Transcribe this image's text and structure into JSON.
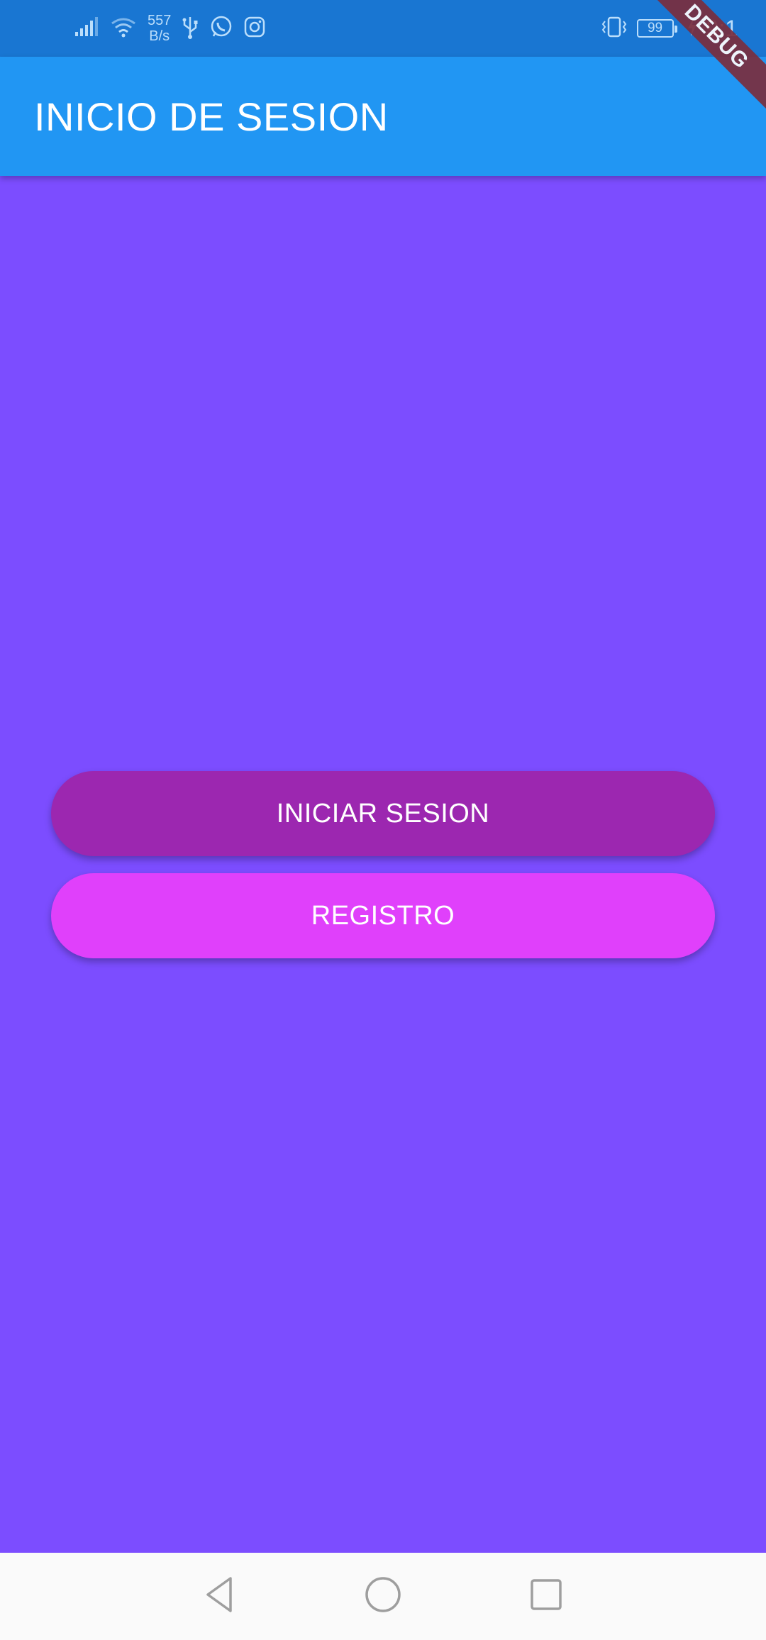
{
  "status_bar": {
    "net_speed_value": "557",
    "net_speed_unit": "B/s",
    "battery_level": "99",
    "time": "9:1",
    "icons": [
      "signal-icon",
      "wifi-icon",
      "usb-icon",
      "whatsapp-icon",
      "instagram-icon",
      "vibrate-icon",
      "battery-icon",
      "charging-icon"
    ]
  },
  "debug_banner": "DEBUG",
  "app_bar": {
    "title": "INICIO DE SESION",
    "background": "#2196f3"
  },
  "main": {
    "background": "#7c4dff",
    "login_button": {
      "label": "INICIAR SESION",
      "color": "#9c27b0"
    },
    "register_button": {
      "label": "REGISTRO",
      "color": "#e040fb"
    }
  },
  "nav_bar": {
    "icons": [
      "back-icon",
      "home-icon",
      "recents-icon"
    ]
  }
}
